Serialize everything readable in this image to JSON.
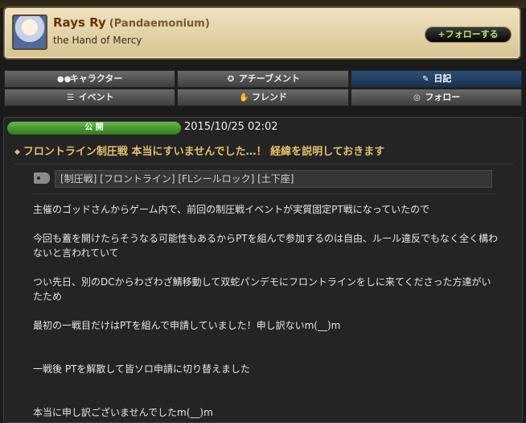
{
  "profile": {
    "name": "Rays Ry",
    "world": "(Pandaemonium)",
    "title": "the Hand of Mercy",
    "follow_label": "+フォローする"
  },
  "nav": {
    "row1": [
      {
        "label": "キャラクター",
        "icon": "people-icon"
      },
      {
        "label": "アチーブメント",
        "icon": "medal-icon"
      },
      {
        "label": "日記",
        "icon": "quill-icon",
        "active": true
      }
    ],
    "row2": [
      {
        "label": "イベント",
        "icon": "list-icon"
      },
      {
        "label": "フレンド",
        "icon": "handshake-icon"
      },
      {
        "label": "フォロー",
        "icon": "binoculars-icon"
      }
    ]
  },
  "post": {
    "status": "公 開",
    "date": "2015/10/25 02:02",
    "title": "フロントライン制圧戦 本当にすいませんでした…！ 経緯を説明しておきます",
    "tags": "[制圧戦] [フロントライン] [FLシールロック] [土下座]",
    "paragraphs": [
      "主催のゴッドさんからゲーム内で、前回の制圧戦イベントが実質固定PT戦になっていたので",
      "今回も蓋を開けたらそうなる可能性もあるからPTを組んで参加するのは自由、ルール違反でもなく全く構わないと言われていて",
      "つい先日、別のDCからわざわざ鯖移動して双蛇パンデモにフロントラインをしに来てくださった方達がいたため",
      "最初の一戦目だけはPTを組んで申請していました！申し訳ないm(__)m",
      "一戦後 PTを解散して皆ソロ申請に切り替えました",
      "本当に申し訳ございませんでしたm(__)m"
    ]
  },
  "colors": {
    "accent_gold": "#e2c06a",
    "active_tab": "#1f3f63",
    "public_green": "#4a9d32",
    "name_brown": "#6b3300"
  }
}
